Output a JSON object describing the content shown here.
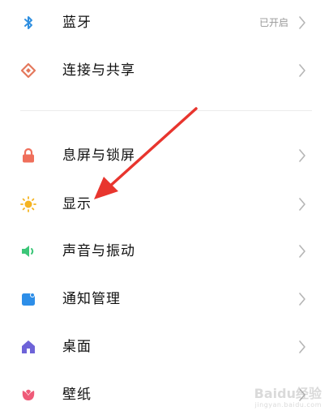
{
  "settings": {
    "items": [
      {
        "label": "蓝牙",
        "status": "已开启",
        "icon": "bluetooth-icon",
        "color": "#2f8fe0"
      },
      {
        "label": "连接与共享",
        "status": "",
        "icon": "connection-share-icon",
        "color": "#e4785c"
      },
      {
        "label": "息屏与锁屏",
        "status": "",
        "icon": "lock-icon",
        "color": "#ef6f5b"
      },
      {
        "label": "显示",
        "status": "",
        "icon": "sun-icon",
        "color": "#f5b422"
      },
      {
        "label": "声音与振动",
        "status": "",
        "icon": "speaker-icon",
        "color": "#3cc678"
      },
      {
        "label": "通知管理",
        "status": "",
        "icon": "notification-icon",
        "color": "#2d8ee8"
      },
      {
        "label": "桌面",
        "status": "",
        "icon": "home-icon",
        "color": "#6e63d8"
      },
      {
        "label": "壁纸",
        "status": "",
        "icon": "wallpaper-icon",
        "color": "#ef5a78"
      }
    ]
  },
  "annotation": {
    "arrow_color": "#e8352e",
    "points_to": "显示"
  },
  "watermark": {
    "text": "Baidu经验",
    "subtext": "jingyan.baidu.com"
  }
}
